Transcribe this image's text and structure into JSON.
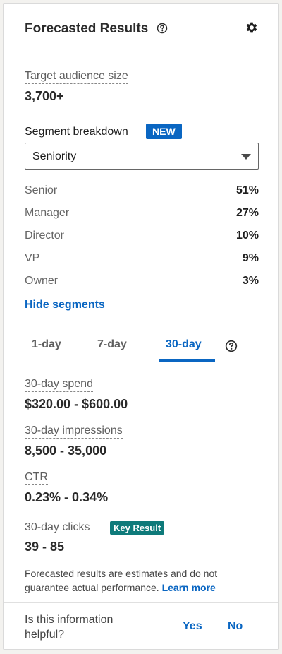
{
  "header": {
    "title": "Forecasted Results"
  },
  "audience": {
    "label": "Target audience size",
    "value": "3,700+"
  },
  "segment": {
    "label": "Segment breakdown",
    "badge": "NEW",
    "selected": "Seniority",
    "rows": [
      {
        "name": "Senior",
        "pct": "51%"
      },
      {
        "name": "Manager",
        "pct": "27%"
      },
      {
        "name": "Director",
        "pct": "10%"
      },
      {
        "name": "VP",
        "pct": "9%"
      },
      {
        "name": "Owner",
        "pct": "3%"
      }
    ],
    "hide_link": "Hide segments"
  },
  "tabs": [
    {
      "label": "1-day",
      "active": false
    },
    {
      "label": "7-day",
      "active": false
    },
    {
      "label": "30-day",
      "active": true
    }
  ],
  "metrics": [
    {
      "label": "30-day spend",
      "value": "$320.00 - $600.00"
    },
    {
      "label": "30-day impressions",
      "value": "8,500 - 35,000"
    },
    {
      "label": "CTR",
      "value": "0.23% - 0.34%"
    },
    {
      "label": "30-day clicks",
      "value": "39 - 85",
      "badge": "Key Result"
    }
  ],
  "disclaimer": {
    "text": "Forecasted results are estimates and do not guarantee actual performance.",
    "link": "Learn more"
  },
  "feedback": {
    "question": "Is this information helpful?",
    "yes": "Yes",
    "no": "No"
  },
  "colors": {
    "accent": "#0a66c2",
    "key_result": "#0e7a7a"
  },
  "icons": [
    "help-circle-icon",
    "gear-icon",
    "chevron-down-icon"
  ]
}
